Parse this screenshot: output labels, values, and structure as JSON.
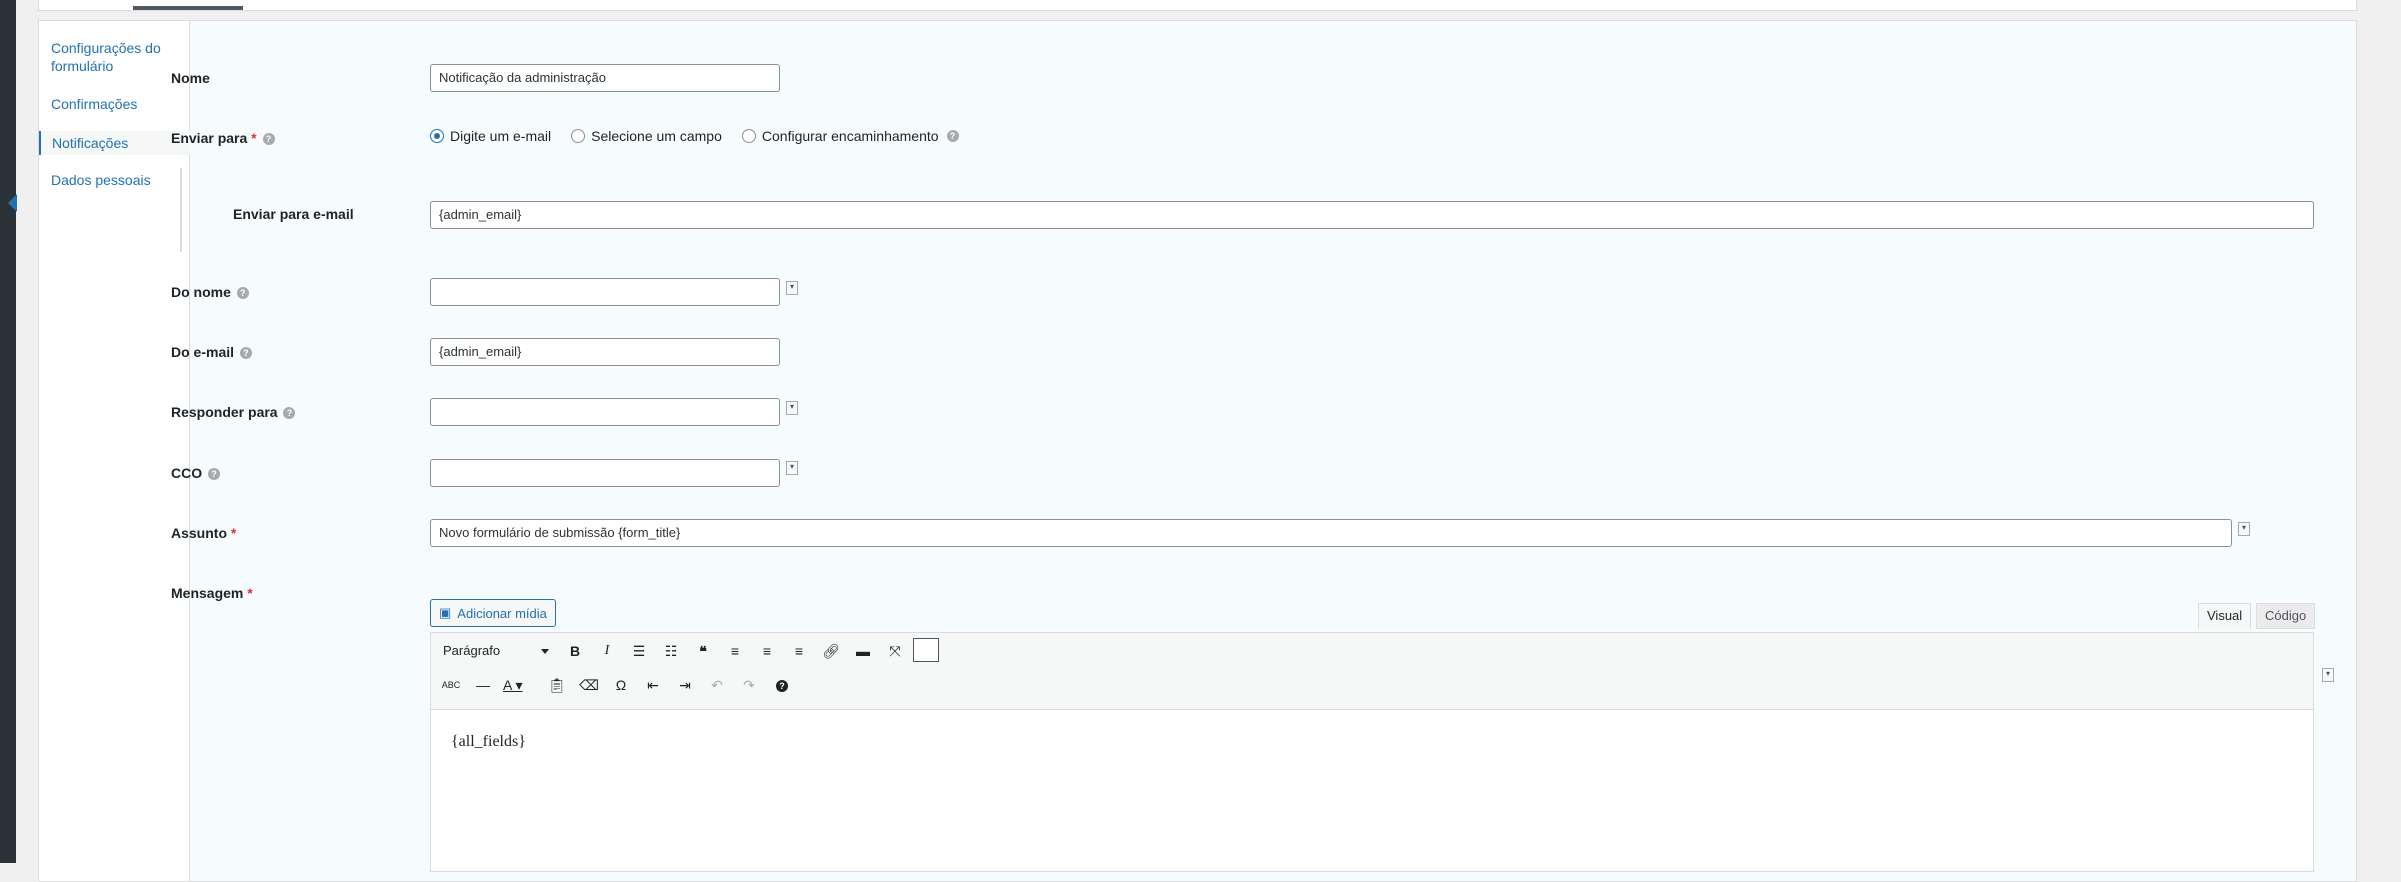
{
  "sidenav": {
    "items": [
      {
        "label": "Configurações do formulário"
      },
      {
        "label": "Confirmações"
      },
      {
        "label": "Notificações"
      },
      {
        "label": "Dados pessoais"
      }
    ]
  },
  "form": {
    "nome_label": "Nome",
    "nome_value": "Notificação da administração",
    "enviar_label": "Enviar para",
    "required_mark": "*",
    "radio_options": [
      "Digite um e-mail",
      "Selecione um campo",
      "Configurar encaminhamento"
    ],
    "selected_option": "Digite um e-mail",
    "enviar_email_label": "Enviar para e-mail",
    "enviar_email_value": "{admin_email}",
    "do_nome_label": "Do nome",
    "do_nome_value": "",
    "do_email_label": "Do e-mail",
    "do_email_value": "{admin_email}",
    "responder_label": "Responder para",
    "responder_value": "",
    "cco_label": "CCO",
    "cco_value": "",
    "assunto_label": "Assunto",
    "assunto_value": "Novo formulário de submissão {form_title}",
    "mensagem_label": "Mensagem"
  },
  "editor": {
    "media_button": "Adicionar mídia",
    "tab_visual": "Visual",
    "tab_code": "Código",
    "format_select": "Parágrafo",
    "content": "{all_fields}",
    "help_glyph": "?"
  }
}
